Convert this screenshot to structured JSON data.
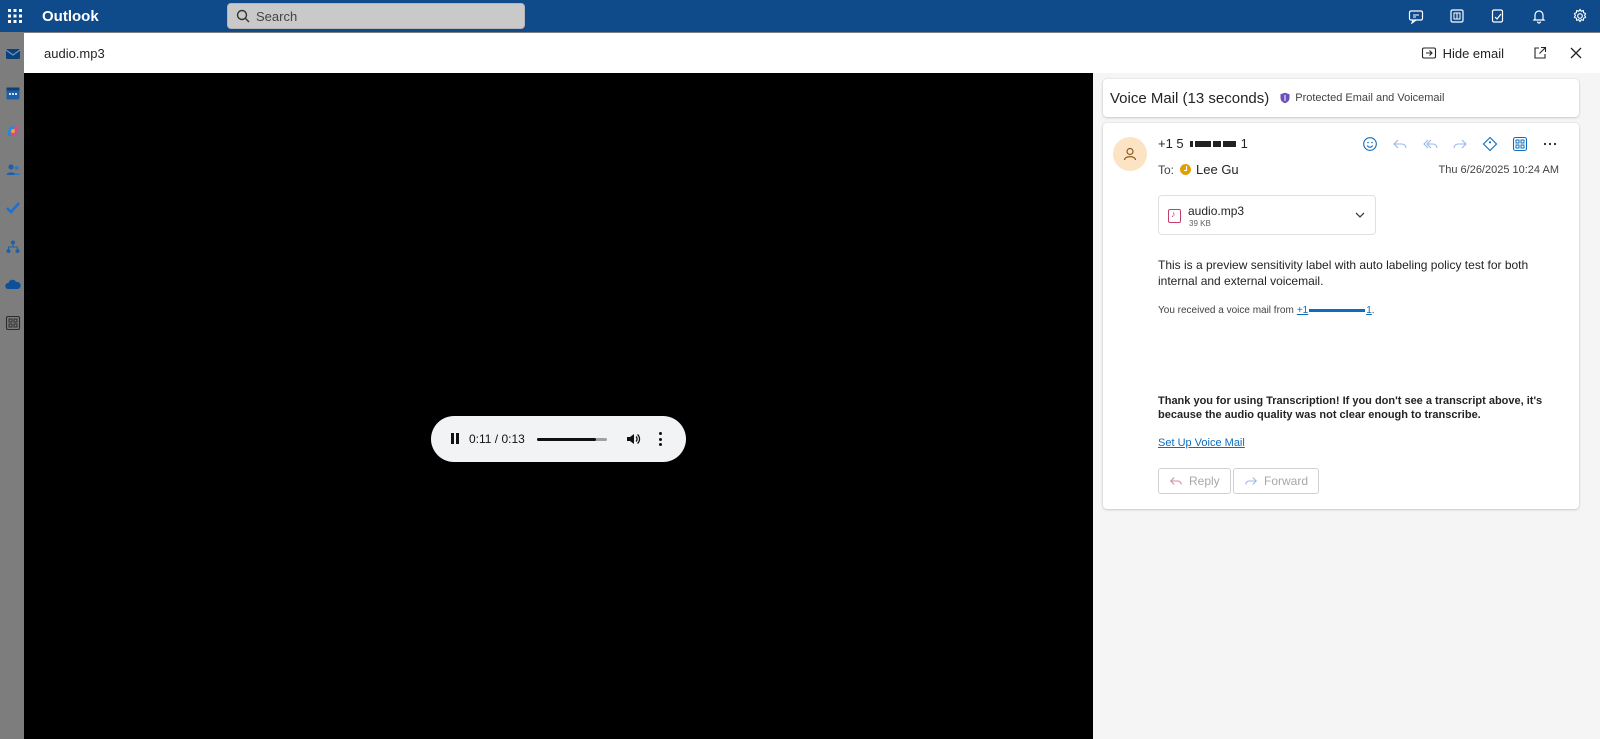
{
  "app": {
    "name": "Outlook"
  },
  "search": {
    "placeholder": "Search"
  },
  "topbar": {
    "icons": [
      "meet-icon",
      "office-icon",
      "notes-icon",
      "bell-icon",
      "gear-icon"
    ]
  },
  "rail": {
    "icons": [
      "mail-icon",
      "calendar-icon",
      "copilot-icon",
      "people-icon",
      "todo-icon",
      "org-icon",
      "onedrive-icon",
      "apps-icon"
    ]
  },
  "dialog": {
    "title": "audio.mp3",
    "hide_email_label": "Hide email"
  },
  "player": {
    "current": "0:11",
    "duration": "0:13",
    "time_display": "0:11 / 0:13",
    "progress_fraction": 0.846
  },
  "email": {
    "subject": "Voice Mail (13 seconds)",
    "label": "Protected Email and Voicemail",
    "sender_prefix": "+1 5",
    "sender_suffix": "1",
    "to_label": "To:",
    "to_name": "Lee Gu",
    "date": "Thu 6/26/2025 10:24 AM",
    "attachment": {
      "name": "audio.mp3",
      "size": "39 KB"
    },
    "body": "This is a preview sensitivity label with auto labeling policy test for both internal and external voicemail.",
    "vm_from_text": "You received a voice mail from",
    "vm_link_prefix": "+1",
    "vm_link_suffix": "1",
    "vm_period": ".",
    "thanks": "Thank you for using Transcription! If you don't see a transcript above, it's because the audio quality was not clear enough to transcribe.",
    "setup_link": "Set Up Voice Mail",
    "reply_label": "Reply",
    "forward_label": "Forward"
  },
  "colors": {
    "topbar": "#0f4a8a",
    "accent": "#0f6cbd",
    "label_shield": "#6b4fbb",
    "presence": "#e0a000"
  }
}
